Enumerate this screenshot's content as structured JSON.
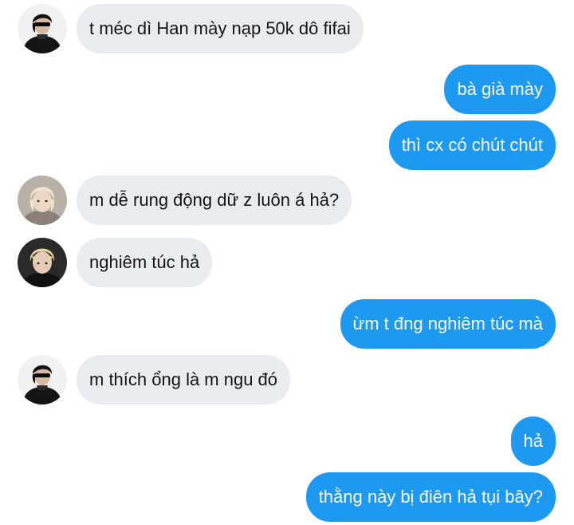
{
  "messages": [
    {
      "sender": "friend-1",
      "direction": "incoming",
      "text": "t méc dì Han mày nạp 50k dô fifai"
    },
    {
      "sender": "me",
      "direction": "outgoing",
      "text": "bà già mày"
    },
    {
      "sender": "me",
      "direction": "outgoing",
      "text": "thì cx có chút chút"
    },
    {
      "sender": "friend-2",
      "direction": "incoming",
      "text": "m dễ rung động dữ z luôn á hả?"
    },
    {
      "sender": "friend-3",
      "direction": "incoming",
      "text": "nghiêm túc hả"
    },
    {
      "sender": "me",
      "direction": "outgoing",
      "text": "ừm t đng nghiêm túc mà"
    },
    {
      "sender": "friend-1",
      "direction": "incoming",
      "text": "m thích ổng là m ngu đó"
    },
    {
      "sender": "me",
      "direction": "outgoing",
      "text": "hả"
    },
    {
      "sender": "me",
      "direction": "outgoing",
      "text": "thằng này bị điên hả tụi bây?"
    }
  ],
  "colors": {
    "incoming_bubble": "#e8ebef",
    "outgoing_bubble": "#1e99f1",
    "incoming_text": "#151515",
    "outgoing_text": "#ffffff"
  },
  "avatars": [
    {
      "id": "friend-1",
      "icon": "person-sunglasses-avatar-icon"
    },
    {
      "id": "friend-2",
      "icon": "person-blonde-hair-avatar-icon"
    },
    {
      "id": "friend-3",
      "icon": "person-blonde-dark-outfit-avatar-icon"
    }
  ]
}
